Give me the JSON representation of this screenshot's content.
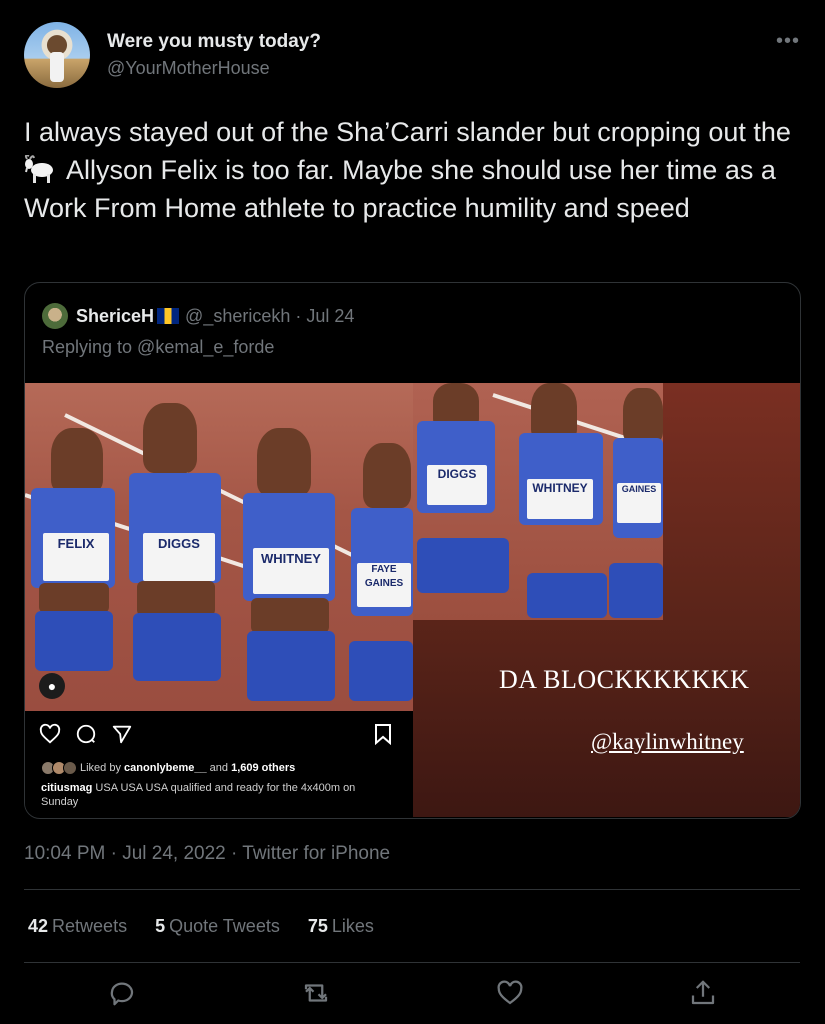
{
  "author": {
    "name": "Were you musty today?",
    "handle": "@YourMotherHouse"
  },
  "more_label": "•••",
  "tweet": {
    "text_before": "I always stayed out of the Sha’Carri slander but cropping out the",
    "text_after": "Allyson Felix is too far. Maybe she should use her time as a Work From Home athlete to practice humility and speed",
    "goat_icon": "goat-icon"
  },
  "quote": {
    "name": "ShericeH",
    "handle": "@_shericekh",
    "date": "· Jul 24",
    "replying_to": "Replying to @kemal_e_forde",
    "instagram": {
      "liked_by_prefix": "Liked by",
      "liked_by_user": "canonlybeme__",
      "liked_by_and": "and",
      "liked_by_others": "1,609 others",
      "caption_user": "citiusmag",
      "caption_text": "USA USA USA qualified and ready for the 4x400m on Sunday",
      "bibs": [
        "FELIX",
        "DIGGS",
        "WHITNEY",
        "FAYE GAINES"
      ]
    },
    "story": {
      "title": "DA BLOCKKKKKKK",
      "tag": "@kaylinwhitney",
      "bibs": [
        "DIGGS",
        "WHITNEY",
        "GAINES"
      ]
    }
  },
  "meta": {
    "time": "10:04 PM · Jul 24, 2022 · Twitter for iPhone"
  },
  "stats": {
    "retweets_count": "42",
    "retweets_label": "Retweets",
    "quotes_count": "5",
    "quotes_label": "Quote Tweets",
    "likes_count": "75",
    "likes_label": "Likes"
  },
  "colors": {
    "background": "#000000",
    "text": "#e7e9ea",
    "muted": "#71767b",
    "border": "#2f3336"
  }
}
